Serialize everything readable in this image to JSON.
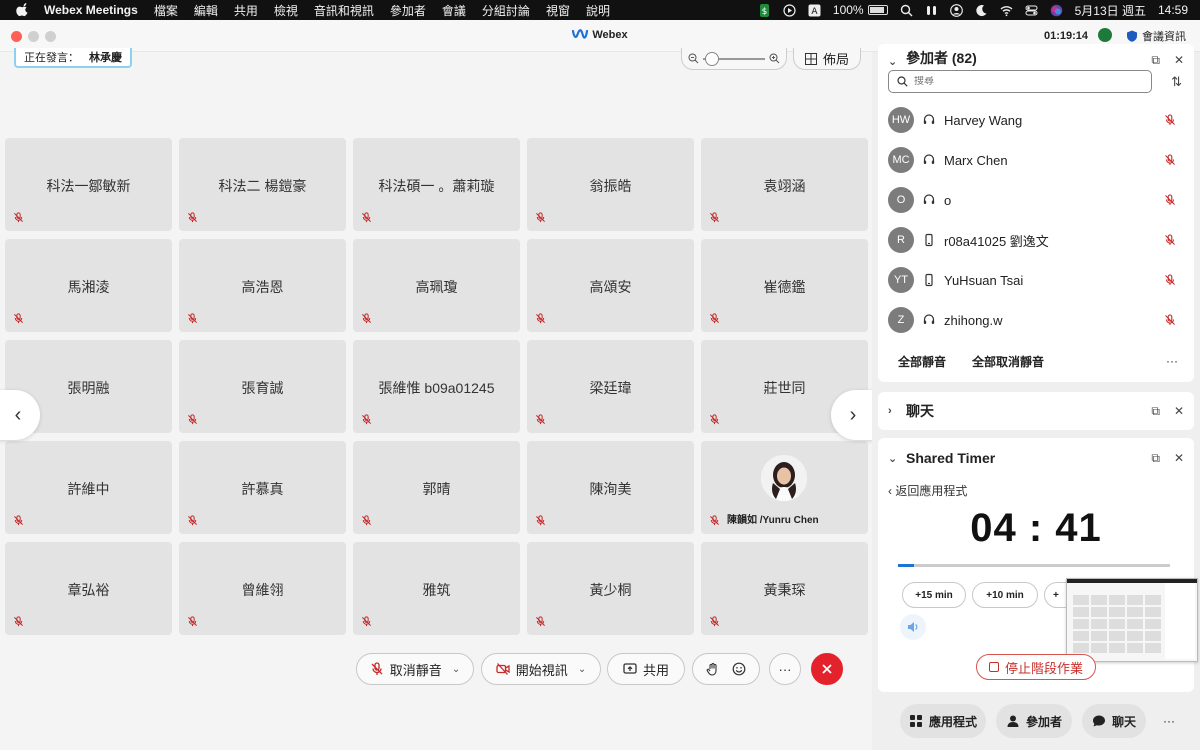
{
  "menubar": {
    "app_name": "Webex Meetings",
    "menus": [
      "檔案",
      "編輯",
      "共用",
      "檢視",
      "音訊和視訊",
      "參加者",
      "會議",
      "分組討論",
      "視窗",
      "說明"
    ],
    "battery": "100%",
    "date": "5月13日 週五",
    "time": "14:59"
  },
  "window": {
    "title": "Webex",
    "elapsed": "01:19:14",
    "info_label": "會議資訊"
  },
  "stage": {
    "speaking_label": "正在發言：",
    "speaker_name": "林承慶",
    "layout_label": "佈局",
    "tiles": [
      {
        "name": "科法一鄒敏新"
      },
      {
        "name": "科法二 楊鎧豪"
      },
      {
        "name": "科法碩一 。蕭莉璇"
      },
      {
        "name": "翁振皓"
      },
      {
        "name": "袁翊涵"
      },
      {
        "name": "馬湘淩"
      },
      {
        "name": "高浩恩"
      },
      {
        "name": "高珮瓊"
      },
      {
        "name": "高頌安"
      },
      {
        "name": "崔德鑑"
      },
      {
        "name": "張明融"
      },
      {
        "name": "張育誠"
      },
      {
        "name": "張維惟 b09a01245"
      },
      {
        "name": "梁廷瑋"
      },
      {
        "name": "莊世同"
      },
      {
        "name": "許維中"
      },
      {
        "name": "許慕真"
      },
      {
        "name": "郭晴"
      },
      {
        "name": "陳洵美"
      },
      {
        "name": "陳韻如 /Yunru Chen"
      },
      {
        "name": "章弘裕"
      },
      {
        "name": "曾維翎"
      },
      {
        "name": "雅筑"
      },
      {
        "name": "黃少桐"
      },
      {
        "name": "黃秉琛"
      }
    ]
  },
  "controls": {
    "mute_label": "取消靜音",
    "video_label": "開始視訊",
    "share_label": "共用",
    "more_label": "···"
  },
  "participants": {
    "header": "參加者 (82)",
    "search_placeholder": "搜尋",
    "items": [
      {
        "initials": "HW",
        "name": "Harvey Wang",
        "device": "headset"
      },
      {
        "initials": "MC",
        "name": "Marx Chen",
        "device": "headset"
      },
      {
        "initials": "O",
        "name": "o",
        "device": "headset"
      },
      {
        "initials": "R",
        "name": "r08a41025 劉逸文",
        "device": "phone"
      },
      {
        "initials": "YT",
        "name": "YuHsuan Tsai",
        "device": "phone"
      },
      {
        "initials": "Z",
        "name": "zhihong.w",
        "device": "headset"
      }
    ],
    "mute_all": "全部靜音",
    "unmute_all": "全部取消靜音",
    "more": "···"
  },
  "chat": {
    "header": "聊天"
  },
  "timer": {
    "header": "Shared Timer",
    "back_label": "返回應用程式",
    "time_display": "04 : 41",
    "progress": 0.06,
    "add_buttons": [
      "+15 min",
      "+10 min",
      "+"
    ],
    "stop_label": "停止階段作業"
  },
  "panel_buttons": {
    "apps": "應用程式",
    "participants": "參加者",
    "chat": "聊天",
    "more": "···"
  },
  "colors": {
    "end_call": "#e3222b",
    "mute_red": "#c62828",
    "progress": "#1e73d6",
    "speaking_border": "#8fd0ec"
  }
}
